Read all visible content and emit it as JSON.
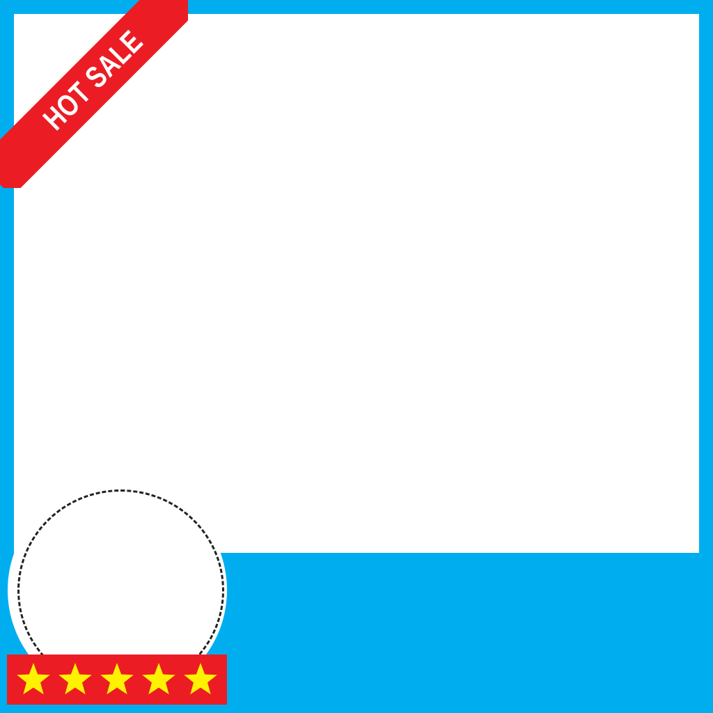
{
  "banner": {
    "label": "HOT SALE"
  },
  "rating": {
    "stars": 5,
    "max": 5
  },
  "colors": {
    "frame_background": "#00aeef",
    "content_area": "#ffffff",
    "ribbon": "#ec1c24",
    "rating_bar": "#ec1c24",
    "star": "#fff200"
  },
  "icons": [
    "star-icon"
  ]
}
